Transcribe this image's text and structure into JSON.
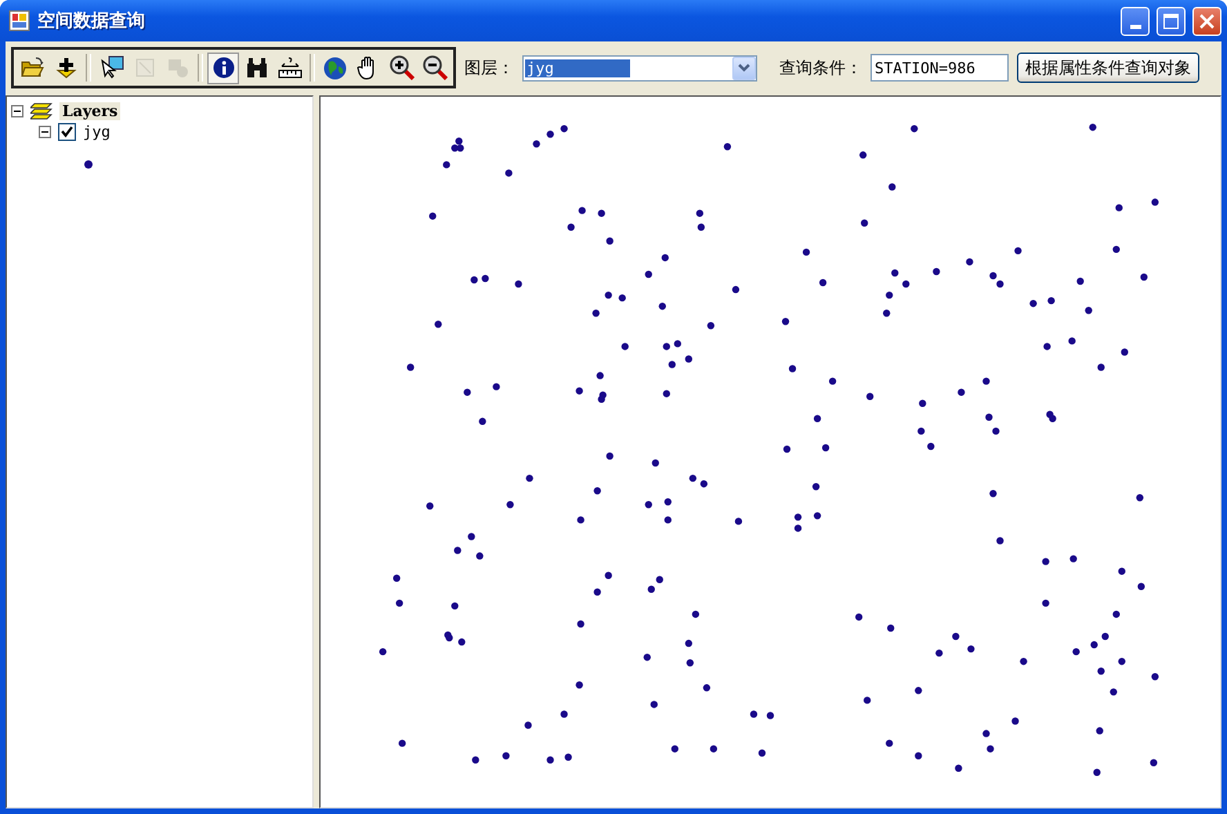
{
  "window": {
    "title": "空间数据查询"
  },
  "toolbar": {
    "tools": [
      {
        "kind": "open",
        "disabled": false,
        "selected": false
      },
      {
        "kind": "add",
        "disabled": false,
        "selected": false
      },
      {
        "kind": "separator"
      },
      {
        "kind": "select",
        "disabled": false,
        "selected": false
      },
      {
        "kind": "clear",
        "disabled": true,
        "selected": false
      },
      {
        "kind": "zoom-selected",
        "disabled": true,
        "selected": false
      },
      {
        "kind": "separator"
      },
      {
        "kind": "identify",
        "disabled": false,
        "selected": true
      },
      {
        "kind": "find",
        "disabled": false,
        "selected": false
      },
      {
        "kind": "measure",
        "disabled": false,
        "selected": false
      },
      {
        "kind": "separator"
      },
      {
        "kind": "full-extent",
        "disabled": false,
        "selected": false
      },
      {
        "kind": "pan",
        "disabled": false,
        "selected": false
      },
      {
        "kind": "zoom-in",
        "disabled": false,
        "selected": false
      },
      {
        "kind": "zoom-out",
        "disabled": false,
        "selected": false
      }
    ]
  },
  "layer_select": {
    "label": "图层：",
    "value": "jyg"
  },
  "query": {
    "label": "查询条件：",
    "value": "STATION=986"
  },
  "query_button": {
    "label": "根据属性条件查询对象"
  },
  "layer_tree": {
    "root": {
      "label": "Layers",
      "expanded": true,
      "children": [
        {
          "label": "jyg",
          "checked": true,
          "expanded": true
        }
      ]
    }
  }
}
